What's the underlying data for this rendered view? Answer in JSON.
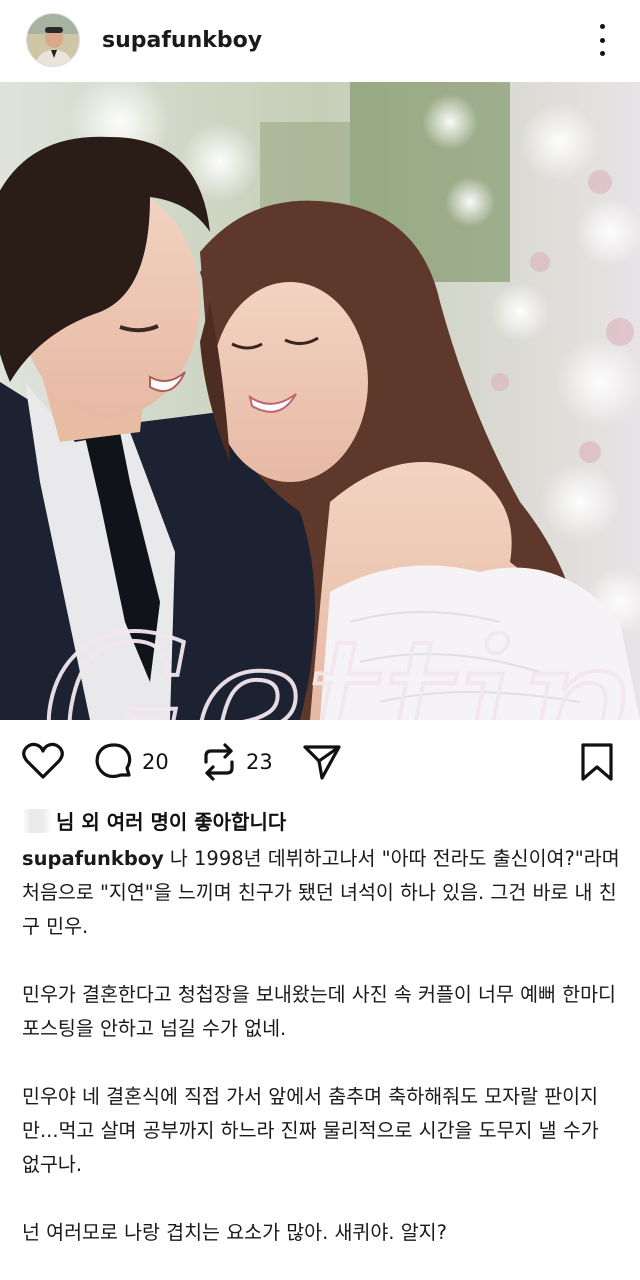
{
  "post": {
    "username": "supafunkboy",
    "image_overlay_text": "Getting",
    "comments_count": "20",
    "reposts_count": "23",
    "likes_text": "님 외 여러 명이 좋아합니다",
    "caption_user": "supafunkboy",
    "paragraphs": [
      "나 1998년 데뷔하고나서 \"아따 전라도 출신이여?\"라며 처음으로 \"지연\"을 느끼며 친구가 됐던 녀석이 하나 있음. 그건 바로 내 친구 민우.",
      "민우가 결혼한다고 청첩장을 보내왔는데 사진 속 커플이 너무 예뻐 한마디 포스팅을 안하고 넘길 수가 없네.",
      "민우야 네 결혼식에 직접 가서 앞에서 춤추며 축하해줘도 모자랄 판이지만...먹고 살며 공부까지 하느라 진짜 물리적으로 시간을 도무지 낼 수가 없구나.",
      "넌 여러모로 나랑 겹치는 요소가 많아. 새퀴야. 알지?"
    ]
  },
  "icons": {
    "more": "more-vertical-icon",
    "like": "heart-icon",
    "comment": "comment-bubble-icon",
    "repost": "repost-icon",
    "share": "send-icon",
    "save": "bookmark-icon"
  },
  "colors": {
    "text": "#111111",
    "background": "#ffffff"
  }
}
